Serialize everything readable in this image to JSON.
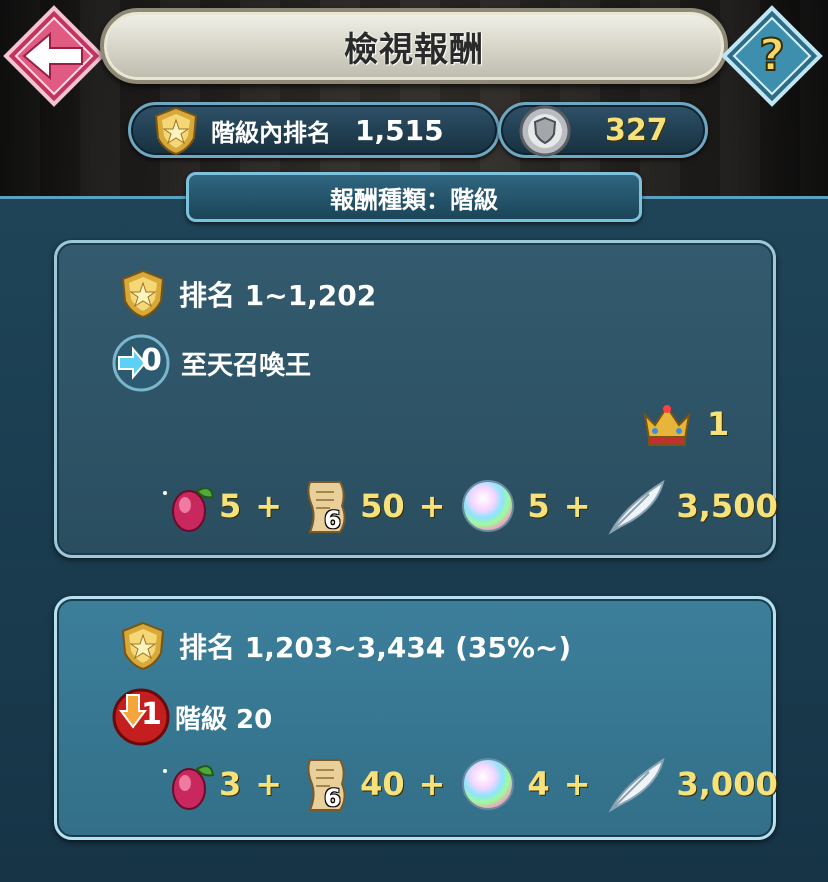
{
  "header": {
    "title": "檢視報酬"
  },
  "stats": {
    "rank_label": "階級內排名",
    "rank_value": "1,515",
    "points_value": "327"
  },
  "reward_type": "報酬種類：階級",
  "tiers": [
    {
      "rank_range": "排名 1~1,202",
      "movement_value": "0",
      "movement_text": "至天召喚王",
      "crown_count": "1",
      "rewards": {
        "fruit": "5",
        "scroll_star": "6",
        "scroll": "50",
        "orb": "5",
        "feather": "3,500"
      }
    },
    {
      "rank_range": "排名 1,203~3,434 (35%~)",
      "movement_value": "1",
      "movement_text": "階級 20",
      "rewards": {
        "fruit": "3",
        "scroll_star": "6",
        "scroll": "40",
        "orb": "4",
        "feather": "3,000"
      }
    }
  ],
  "symbols": {
    "plus": "+"
  },
  "icons": {
    "back": "back-arrow-icon",
    "help": "question-icon",
    "rank_badge": "gold-shield-badge-icon",
    "points_badge": "silver-shield-badge-icon",
    "promote": "promote-arrow-icon",
    "demote": "demote-arrow-icon",
    "crown": "crown-icon",
    "fruit": "divine-fruit-icon",
    "scroll": "scroll-icon",
    "orb": "orb-icon",
    "feather": "feather-icon"
  },
  "colors": {
    "accent_yellow": "#f7e27a",
    "panel_blue": "#1f4458",
    "card_highlight": "#3c7f9b"
  }
}
